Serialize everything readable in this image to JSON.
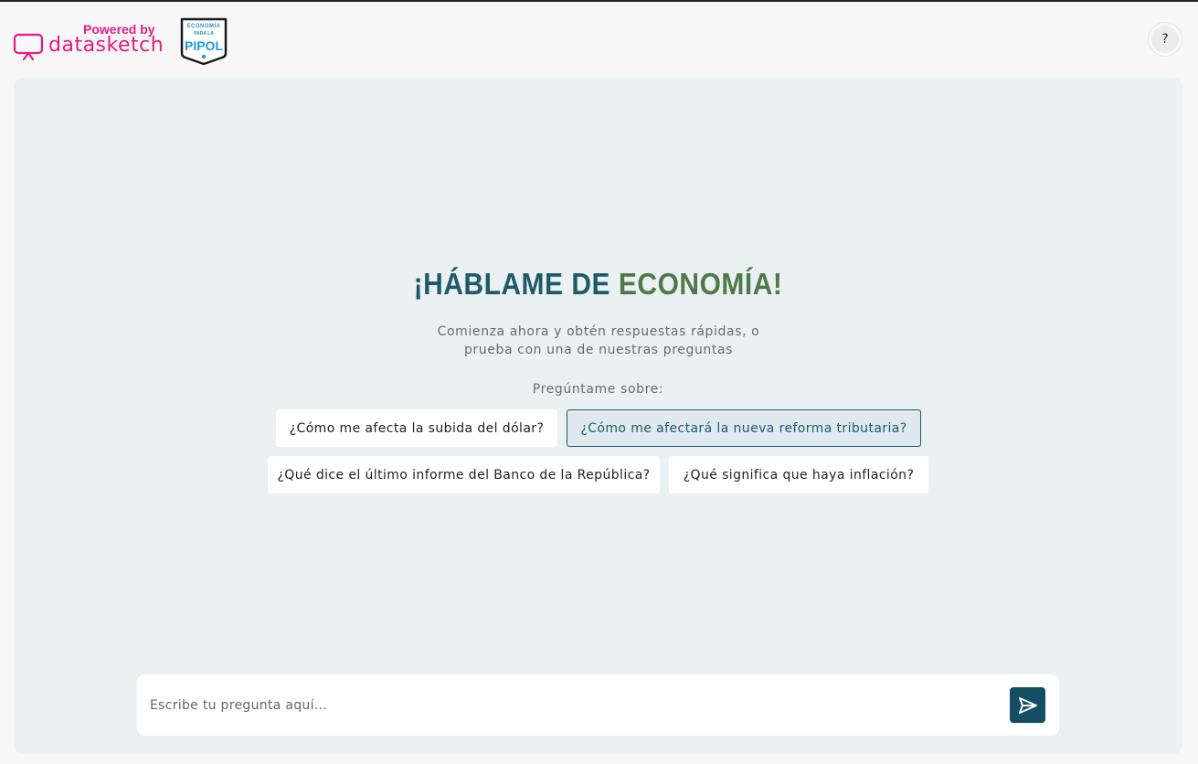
{
  "header": {
    "powered_by": "Powered by",
    "brand_name": "datasketch",
    "badge": {
      "line1": "ECONOMÍA",
      "line2": "PARA LA",
      "line3": "PIPOL"
    },
    "help_label": "?"
  },
  "main": {
    "headline_part1": "¡HÁBLAME DE ",
    "headline_part2": "ECONOMÍA!",
    "subtitle": "Comienza ahora y obtén respuestas rápidas, o prueba con una de nuestras preguntas",
    "ask_label": "Pregúntame sobre:",
    "suggestions": [
      {
        "label": "¿Cómo me afecta la subida del dólar?",
        "active": false
      },
      {
        "label": "¿Cómo me afectará la nueva reforma tributaria?",
        "active": true
      },
      {
        "label": "¿Qué dice el último informe del Banco de la República?",
        "active": false
      },
      {
        "label": "¿Qué significa que haya inflación?",
        "active": false
      }
    ]
  },
  "chat_input": {
    "placeholder": "Escribe tu pregunta aquí...",
    "value": ""
  },
  "colors": {
    "brand_pink": "#e6198a",
    "accent_teal": "#1f5a6b",
    "accent_green": "#4e7a4a",
    "send_button": "#134e63",
    "panel_bg": "#ebf0f2"
  }
}
